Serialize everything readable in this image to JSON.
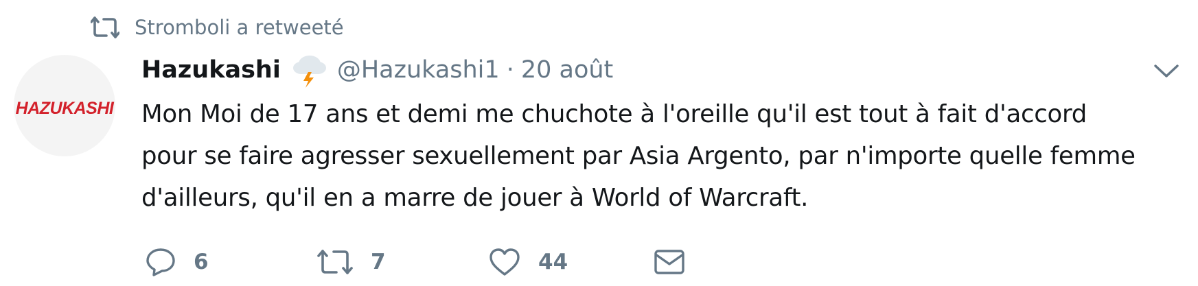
{
  "retweet_context": {
    "text": "Stromboli a retweeté",
    "icon": "retweet-icon"
  },
  "author": {
    "avatar_text": "HAZUKASHI",
    "display_name": "Hazukashi",
    "name_emoji": "cloud-lightning-emoji",
    "handle": "@Hazukashi1",
    "separator": "·",
    "timestamp": "20 août"
  },
  "tweet": {
    "text": "Mon Moi de 17 ans et demi me chuchote à l'oreille qu'il est tout à fait d'accord\npour se faire agresser sexuellement par Asia Argento, par n'importe quelle femme\nd'ailleurs, qu'il en a marre de jouer à World of Warcraft."
  },
  "actions": {
    "reply": {
      "icon": "reply-icon",
      "count": "6"
    },
    "retweet": {
      "icon": "retweet-icon",
      "count": "7"
    },
    "like": {
      "icon": "heart-icon",
      "count": "44"
    },
    "dm": {
      "icon": "envelope-icon"
    }
  },
  "menu": {
    "icon": "chevron-down-icon"
  },
  "colors": {
    "text": "#14171a",
    "muted": "#657786",
    "avatar_red": "#d3212b"
  }
}
